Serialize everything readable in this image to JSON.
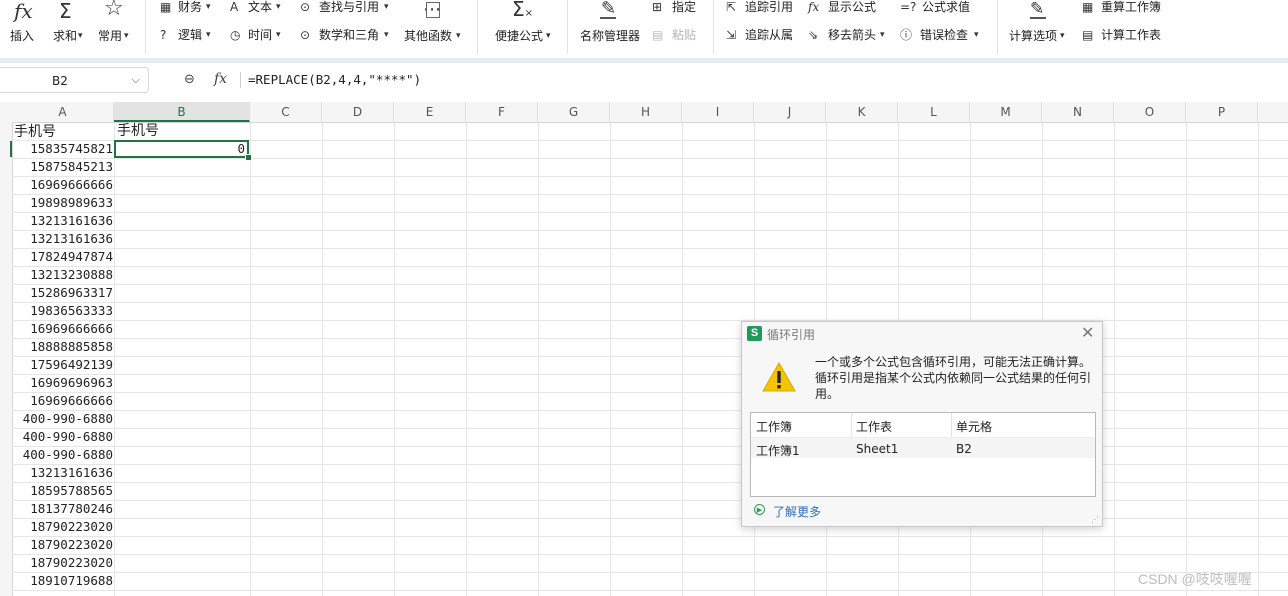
{
  "ribbon": {
    "insert_fn": "插入",
    "autosum": "求和",
    "common": "常用",
    "finance": "财务",
    "text": "文本",
    "lookup": "查找与引用",
    "logic": "逻辑",
    "time": "时间",
    "math": "数学和三角",
    "other_functions": "其他函数",
    "quick_formula": "便捷公式",
    "name_manager": "名称管理器",
    "assign": "指定",
    "paste": "粘贴",
    "trace_precedents": "追踪引用",
    "trace_dependents": "追踪从属",
    "show_formulas": "显示公式",
    "remove_arrows": "移去箭头",
    "evaluate_formula": "公式求值",
    "error_check": "错误检查",
    "calc_options": "计算选项",
    "recalc_workbook": "重算工作簿",
    "calc_sheet": "计算工作表"
  },
  "formula_bar": {
    "name_box": "B2",
    "fx": "fx",
    "formula": "=REPLACE(B2,4,4,\"****\")"
  },
  "sheet": {
    "columns": [
      "A",
      "B",
      "C",
      "D",
      "E",
      "F",
      "G",
      "H",
      "I",
      "J",
      "K",
      "L",
      "M",
      "N",
      "O",
      "P"
    ],
    "a_header": "手机号",
    "b_header": "手机号",
    "b2_value": "0",
    "a_values": [
      "15835745821",
      "15875845213",
      "16969666666",
      "19898989633",
      "13213161636",
      "13213161636",
      "17824947874",
      "13213230888",
      "15286963317",
      "19836563333",
      "16969666666",
      "18888885858",
      "17596492139",
      "16969696963",
      "16969666666",
      "400-990-6880",
      "400-990-6880",
      "400-990-6880",
      "13213161636",
      "18595788565",
      "18137780246",
      "18790223020",
      "18790223020",
      "18790223020",
      "18910719688"
    ]
  },
  "dialog": {
    "logo": "S",
    "title": "循环引用",
    "message": "一个或多个公式包含循环引用，可能无法正确计算。循环引用是指某个公式内依赖同一公式结果的任何引用。",
    "col_workbook": "工作簿",
    "col_sheet": "工作表",
    "col_cell": "单元格",
    "row_workbook": "工作簿1",
    "row_sheet": "Sheet1",
    "row_cell": "B2",
    "learn_more": "了解更多"
  },
  "watermark": "CSDN @吱吱喔喔",
  "colors": {
    "accent_green": "#217346",
    "link_blue": "#2f6fb8",
    "warn_yellow": "#f5c400"
  }
}
